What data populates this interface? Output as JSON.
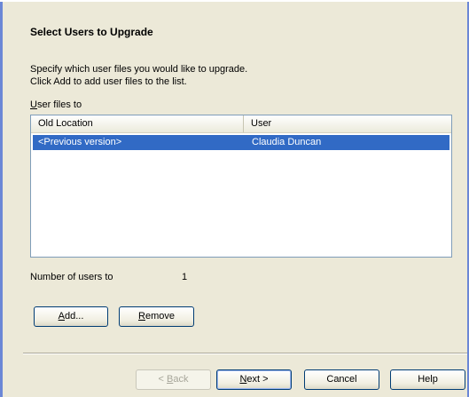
{
  "header": {
    "title": "Select Users to Upgrade"
  },
  "description": {
    "line1": "Specify which user files you would like to upgrade.",
    "line2": "Click Add to add user files to the list."
  },
  "list": {
    "label_first": "U",
    "label_rest": "ser files to",
    "columns": [
      "Old Location",
      "User"
    ],
    "rows": [
      {
        "old_location": "<Previous version>",
        "user": "Claudia Duncan",
        "selected": true
      }
    ]
  },
  "count": {
    "label": "Number of users to",
    "value": "1"
  },
  "buttons": {
    "add": {
      "mnemonic": "A",
      "rest": "dd..."
    },
    "remove": {
      "mnemonic": "R",
      "rest": "emove"
    },
    "back": {
      "prefix": "< ",
      "mnemonic": "B",
      "rest": "ack"
    },
    "next": {
      "mnemonic": "N",
      "rest": "ext >"
    },
    "cancel": "Cancel",
    "help": "Help"
  },
  "colors": {
    "background": "#ece9d8",
    "selection": "#316ac5",
    "frame_accent": "#6b87d6",
    "button_border": "#003c74"
  }
}
